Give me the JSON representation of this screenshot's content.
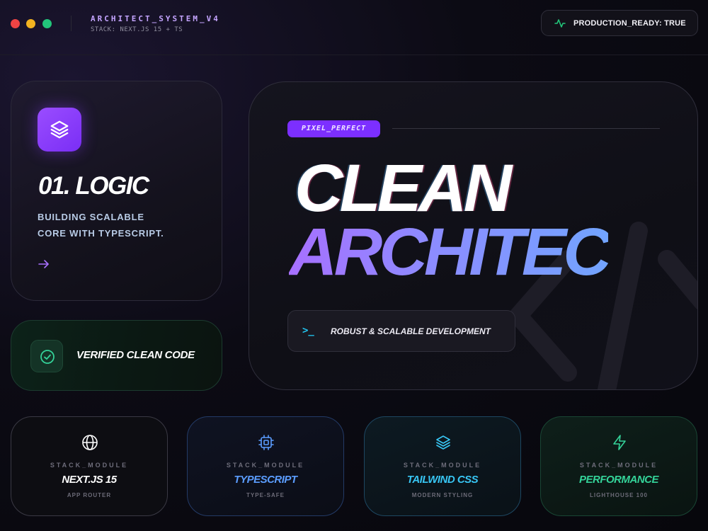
{
  "header": {
    "window_controls": [
      "close",
      "minimize",
      "maximize"
    ],
    "system_name": "ARCHITECT_SYSTEM_V4",
    "stack_line": "STACK: NEXT.JS 15 + TS",
    "status_label": "PRODUCTION_READY: TRUE",
    "status_icon": "activity-icon"
  },
  "logic_card": {
    "icon": "layers-icon",
    "title": "01. LOGIC",
    "description_line1": "BUILDING SCALABLE",
    "description_line2": "CORE WITH TYPESCRIPT.",
    "arrow_icon": "arrow-right-icon"
  },
  "verified_card": {
    "icon": "check-circle-icon",
    "label": "VERIFIED CLEAN CODE"
  },
  "hero": {
    "badge": "PIXEL_PERFECT",
    "headline_line1": "CLEAN",
    "headline_line2": "ARCHITEC",
    "terminal_prompt": ">_",
    "terminal_text": "ROBUST & SCALABLE DEVELOPMENT"
  },
  "modules": [
    {
      "eyebrow": "STACK_MODULE",
      "title": "NEXT.JS 15",
      "subtitle": "APP ROUTER",
      "icon": "globe-icon",
      "color": "#ffffff"
    },
    {
      "eyebrow": "STACK_MODULE",
      "title": "TYPESCRIPT",
      "subtitle": "TYPE-SAFE",
      "icon": "cpu-icon",
      "color": "#5b9dff"
    },
    {
      "eyebrow": "STACK_MODULE",
      "title": "TAILWIND CSS",
      "subtitle": "MODERN STYLING",
      "icon": "layers-icon",
      "color": "#38c6f4"
    },
    {
      "eyebrow": "STACK_MODULE",
      "title": "PERFORMANCE",
      "subtitle": "LIGHTHOUSE 100",
      "icon": "zap-icon",
      "color": "#34d399"
    }
  ],
  "colors": {
    "accent_purple": "#7c2fff",
    "accent_green": "#22c57a",
    "accent_cyan": "#22c3ee",
    "accent_blue": "#5b9dff"
  }
}
